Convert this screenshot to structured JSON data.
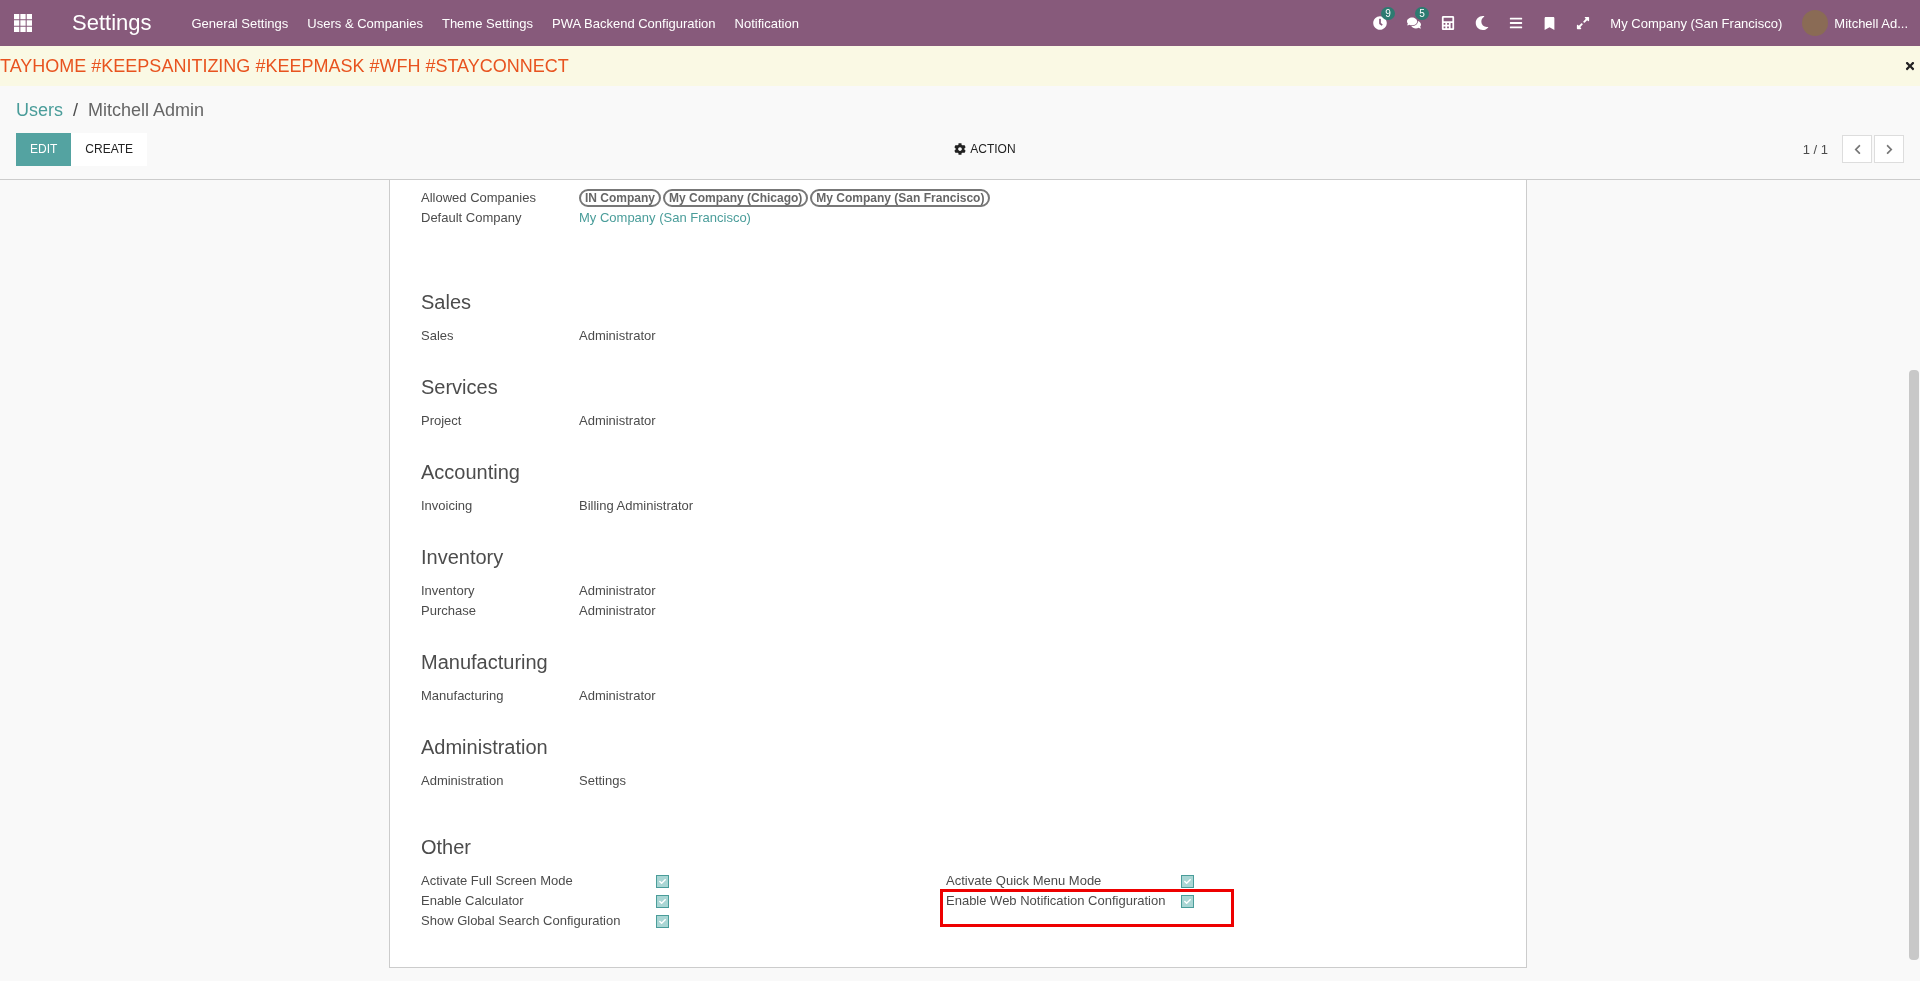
{
  "navbar": {
    "app_title": "Settings",
    "menu": [
      "General Settings",
      "Users & Companies",
      "Theme Settings",
      "PWA Backend Configuration",
      "Notification"
    ],
    "activity_badge": "9",
    "message_badge": "5",
    "company": "My Company (San Francisco)",
    "user": "Mitchell Ad..."
  },
  "banner": {
    "text": "TAYHOME #KEEPSANITIZING #KEEPMASK #WFH #STAYCONNECT"
  },
  "breadcrumb": {
    "parent": "Users",
    "separator": "/",
    "current": "Mitchell Admin"
  },
  "buttons": {
    "edit": "EDIT",
    "create": "CREATE",
    "action": "ACTION"
  },
  "pager": "1 / 1",
  "companies": {
    "allowed_label": "Allowed Companies",
    "allowed": [
      "IN Company",
      "My Company (Chicago)",
      "My Company (San Francisco)"
    ],
    "default_label": "Default Company",
    "default": "My Company (San Francisco)"
  },
  "sections": [
    {
      "title": "Sales",
      "fields": [
        {
          "label": "Sales",
          "value": "Administrator"
        }
      ]
    },
    {
      "title": "Services",
      "fields": [
        {
          "label": "Project",
          "value": "Administrator"
        }
      ]
    },
    {
      "title": "Accounting",
      "fields": [
        {
          "label": "Invoicing",
          "value": "Billing Administrator"
        }
      ]
    },
    {
      "title": "Inventory",
      "fields": [
        {
          "label": "Inventory",
          "value": "Administrator"
        },
        {
          "label": "Purchase",
          "value": "Administrator"
        }
      ]
    },
    {
      "title": "Manufacturing",
      "fields": [
        {
          "label": "Manufacturing",
          "value": "Administrator"
        }
      ]
    },
    {
      "title": "Administration",
      "fields": [
        {
          "label": "Administration",
          "value": "Settings"
        }
      ]
    }
  ],
  "other": {
    "title": "Other",
    "left": [
      {
        "label": "Activate Full Screen Mode",
        "checked": true
      },
      {
        "label": "Enable Calculator",
        "checked": true
      },
      {
        "label": "Show Global Search Configuration",
        "checked": true
      }
    ],
    "right": [
      {
        "label": "Activate Quick Menu Mode",
        "checked": true,
        "highlighted": false
      },
      {
        "label": "Enable Web Notification Configuration",
        "checked": true,
        "highlighted": true
      }
    ]
  }
}
